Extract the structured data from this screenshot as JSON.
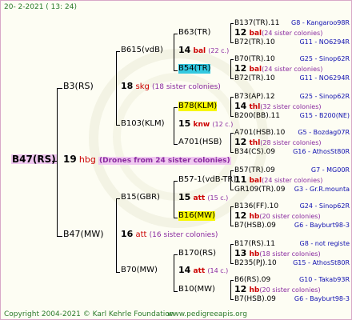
{
  "header": {
    "date": "20-  2-2021  ( 13: 24)"
  },
  "root": {
    "name": "B47(RS)",
    "num": "19",
    "abbr": "hbg",
    "colonies": "(Drones from 24 sister colonies)"
  },
  "g1": [
    {
      "name": "B3(RS)",
      "num": "18",
      "abbr": "skg",
      "colonies": "(18 sister colonies)"
    },
    {
      "name": "B47(MW)",
      "num": "16",
      "abbr": "att",
      "colonies": "(16 sister colonies)"
    }
  ],
  "g2": [
    {
      "name": "B615(vdB)",
      "num": "14",
      "abbr": "bal",
      "colonies": "(22 c.)"
    },
    {
      "name": "B103(KLM)",
      "num": "15",
      "abbr": "knw",
      "colonies": "(12 c.)"
    },
    {
      "name": "B15(GBR)",
      "num": "15",
      "abbr": "att",
      "colonies": "(15 c.)"
    },
    {
      "name": "B70(MW)",
      "num": "14",
      "abbr": "att",
      "colonies": "(14 c.)"
    }
  ],
  "g3": [
    {
      "name": "B63(TR)",
      "num": "12",
      "abbr": "bal",
      "colonies": "(24 sister colonies)"
    },
    {
      "name": "B54(TR)",
      "num": "12",
      "abbr": "bal",
      "colonies": "(24 sister colonies)"
    },
    {
      "name": "B78(KLM)",
      "num": "14",
      "abbr": "thl",
      "colonies": "(32 sister colonies)"
    },
    {
      "name": "A701(HSB)",
      "num": "12",
      "abbr": "thl",
      "colonies": "(28 sister colonies)"
    },
    {
      "name": "B57-1(vdB-TR)",
      "num": "11",
      "abbr": "bal",
      "colonies": "(24 sister colonies)"
    },
    {
      "name": "B16(MW)",
      "num": "12",
      "abbr": "hb",
      "colonies": "(20 sister colonies)"
    },
    {
      "name": "B170(RS)",
      "num": "13",
      "abbr": "hb",
      "colonies": "(18 sister colonies)"
    },
    {
      "name": "B10(MW)",
      "num": "12",
      "abbr": "hb",
      "colonies": "(20 sister colonies)"
    }
  ],
  "g4": [
    {
      "name": "B137(TR).11",
      "detail": "G8 - Kangaroo98R"
    },
    {
      "name": "B72(TR).10",
      "detail": "G11 - NO6294R"
    },
    {
      "name": "B70(TR).10",
      "detail": "G25 - Sinop62R"
    },
    {
      "name": "B72(TR).10",
      "detail": "G11 - NO6294R"
    },
    {
      "name": "B73(AP).12",
      "detail": "G25 - Sinop62R"
    },
    {
      "name": "B200(BB).11",
      "detail": "G15 - B200(NE)"
    },
    {
      "name": "A701(HSB).10",
      "detail": "G5 - Bozdag07R"
    },
    {
      "name": "B34(CS).09",
      "detail": "G16 - AthosSt80R"
    },
    {
      "name": "B57(TR).09",
      "detail": "G7 - MG00R"
    },
    {
      "name": "GR109(TR).09",
      "detail": "G3 - Gr.R.mounta"
    },
    {
      "name": "B136(FF).10",
      "detail": "G24 - Sinop62R"
    },
    {
      "name": "B7(HSB).09",
      "detail": "G6 - Bayburt98-3"
    },
    {
      "name": "B17(RS).11",
      "detail": "G8 - not registe"
    },
    {
      "name": "B235(PJ).10",
      "detail": "G15 - AthosSt80R"
    },
    {
      "name": "B6(RS).09",
      "detail": "G10 - Takab93R"
    },
    {
      "name": "B7(HSB).09",
      "detail": "G6 - Bayburt98-3"
    }
  ],
  "footer": {
    "copyright": "Copyright 2004-2021 © Karl Kehrle Foundation",
    "url": "www.pedigreeapis.org"
  }
}
